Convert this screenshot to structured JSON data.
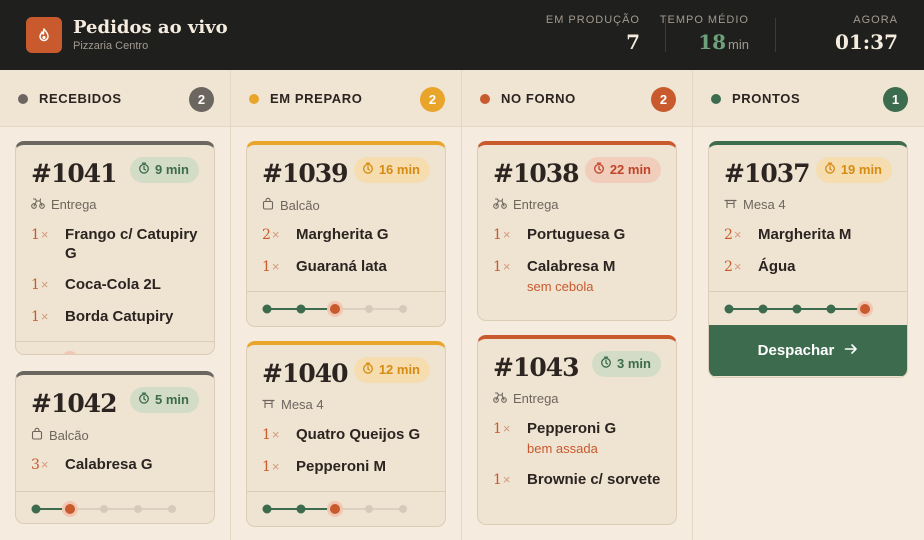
{
  "header": {
    "title": "Pedidos ao vivo",
    "subtitle": "Pizzaria Centro",
    "stats": {
      "production": {
        "label": "EM PRODUÇÃO",
        "value": "7"
      },
      "avg": {
        "label": "TEMPO MÉDIO",
        "value": "18",
        "unit": "min"
      },
      "now": {
        "label": "AGORA",
        "value": "01:37"
      }
    }
  },
  "colors": {
    "brand": "#c85a2e",
    "received": "#6b6660",
    "preparing": "#e9a52a",
    "oven": "#c85a2e",
    "ready": "#3d6b4d"
  },
  "columns": [
    {
      "title": "RECEBIDOS",
      "count": "2",
      "cards": [
        {
          "number": "#1041",
          "timer": "9 min",
          "type": "Entrega",
          "type_icon": "bike-icon",
          "items": [
            {
              "qty": "1",
              "name": "Frango c/ Catupiry G"
            },
            {
              "qty": "1",
              "name": "Coca-Cola 2L"
            },
            {
              "qty": "1",
              "name": "Borda Catupiry"
            }
          ],
          "progress": 1
        },
        {
          "number": "#1042",
          "timer": "5 min",
          "type": "Balcão",
          "type_icon": "bag-icon",
          "items": [
            {
              "qty": "3",
              "name": "Calabresa G"
            }
          ],
          "progress": 1
        }
      ]
    },
    {
      "title": "EM PREPARO",
      "count": "2",
      "cards": [
        {
          "number": "#1039",
          "timer": "16 min",
          "type": "Balcão",
          "type_icon": "bag-icon",
          "items": [
            {
              "qty": "2",
              "name": "Margherita G"
            },
            {
              "qty": "1",
              "name": "Guaraná lata"
            }
          ],
          "progress": 2
        },
        {
          "number": "#1040",
          "timer": "12 min",
          "type": "Mesa 4",
          "type_icon": "table-icon",
          "items": [
            {
              "qty": "1",
              "name": "Quatro Queijos G"
            },
            {
              "qty": "1",
              "name": "Pepperoni M"
            }
          ],
          "progress": 2
        }
      ]
    },
    {
      "title": "NO FORNO",
      "count": "2",
      "cards": [
        {
          "number": "#1038",
          "timer": "22 min",
          "type": "Entrega",
          "type_icon": "bike-icon",
          "items": [
            {
              "qty": "1",
              "name": "Portuguesa G"
            },
            {
              "qty": "1",
              "name": "Calabresa M",
              "note": "sem cebola"
            }
          ]
        },
        {
          "number": "#1043",
          "timer": "3 min",
          "type": "Entrega",
          "type_icon": "bike-icon",
          "items": [
            {
              "qty": "1",
              "name": "Pepperoni G",
              "note": "bem assada"
            },
            {
              "qty": "1",
              "name": "Brownie c/ sorvete"
            }
          ]
        }
      ]
    },
    {
      "title": "PRONTOS",
      "count": "1",
      "cards": [
        {
          "number": "#1037",
          "timer": "19 min",
          "type": "Mesa 4",
          "type_icon": "table-icon",
          "items": [
            {
              "qty": "2",
              "name": "Margherita M"
            },
            {
              "qty": "2",
              "name": "Água"
            }
          ],
          "progress": 4,
          "action": "Despachar"
        }
      ]
    }
  ],
  "qty_suffix": "×"
}
